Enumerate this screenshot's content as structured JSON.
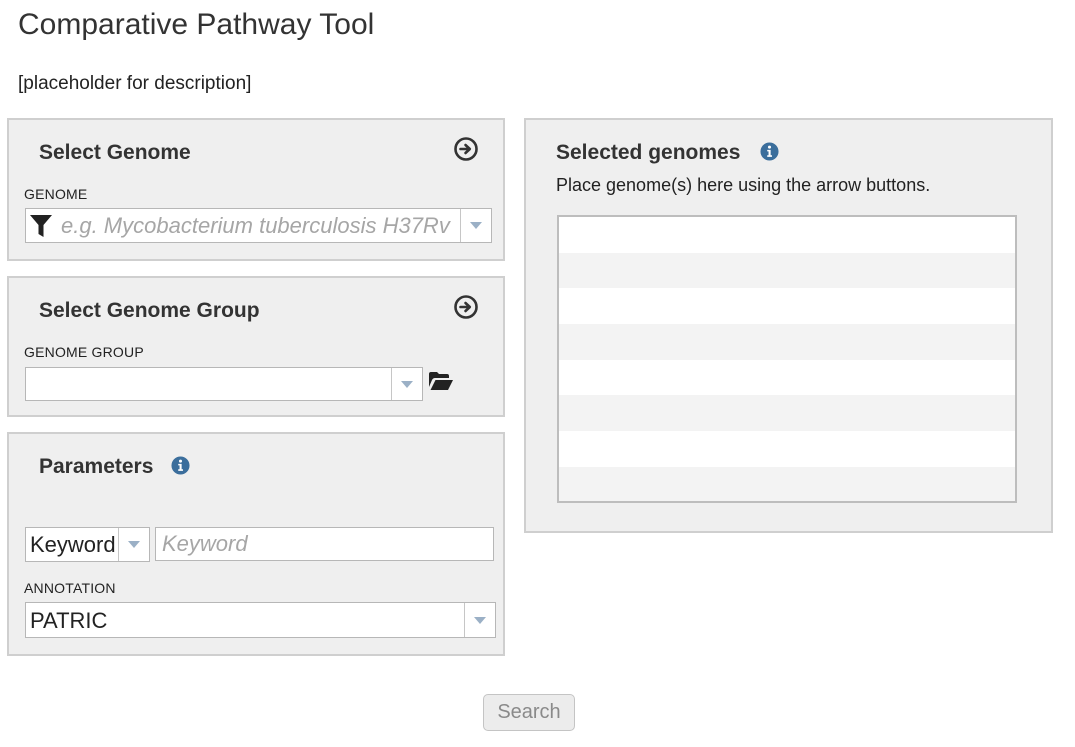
{
  "page": {
    "title": "Comparative Pathway Tool",
    "description": "[placeholder for description]"
  },
  "select_genome": {
    "title": "Select Genome",
    "field_label": "GENOME",
    "placeholder": "e.g. Mycobacterium tuberculosis H37Rv",
    "value": "",
    "icons": [
      "arrow-right-circle-icon",
      "filter-funnel-icon",
      "chevron-down-icon"
    ]
  },
  "select_genome_group": {
    "title": "Select Genome Group",
    "field_label": "GENOME GROUP",
    "value": "",
    "icons": [
      "arrow-right-circle-icon",
      "chevron-down-icon",
      "folder-open-icon"
    ]
  },
  "parameters": {
    "title": "Parameters",
    "keyword_type": "Keyword",
    "keyword_placeholder": "Keyword",
    "keyword_value": "",
    "annotation_label": "ANNOTATION",
    "annotation_value": "PATRIC",
    "icons": [
      "info-icon",
      "chevron-down-icon"
    ]
  },
  "selected_genomes": {
    "title": "Selected genomes",
    "hint": "Place genome(s) here using the arrow buttons.",
    "items": [],
    "icons": [
      "info-icon"
    ]
  },
  "actions": {
    "search_label": "Search",
    "search_enabled": false
  },
  "colors": {
    "panel_background": "#efefef",
    "panel_border": "#cfcfcf",
    "icon_dark": "#333333",
    "info_icon": "#3b6e9c",
    "dropdown_arrow": "#9bb0c6",
    "placeholder_text": "#a6a6a6"
  }
}
